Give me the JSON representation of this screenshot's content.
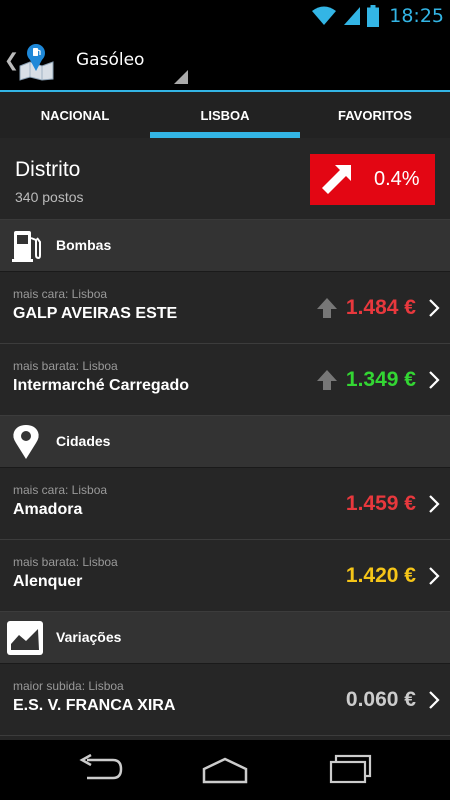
{
  "status_bar": {
    "time": "18:25",
    "icons": [
      "wifi-icon",
      "signal-icon",
      "battery-icon"
    ]
  },
  "action_bar": {
    "back_icon": "chevron-left-icon",
    "app_icon": "fuel-map-icon",
    "fuel_type": "Gasóleo"
  },
  "tabs": [
    {
      "label": "NACIONAL",
      "active": false
    },
    {
      "label": "LISBOA",
      "active": true
    },
    {
      "label": "FAVORITOS",
      "active": false
    }
  ],
  "district": {
    "title": "Distrito",
    "subtitle": "340 postos",
    "variation": "0.4%",
    "variation_icon": "arrow-up-right-icon",
    "variation_color": "#e30613"
  },
  "sections": {
    "bombas": {
      "label": "Bombas",
      "icon": "fuel-pump-icon",
      "rows": [
        {
          "caption": "mais cara: Lisboa",
          "name": "GALP AVEIRAS ESTE",
          "price": "1.484 €",
          "price_color": "#e8383d",
          "trend_icon": "arrow-up-icon"
        },
        {
          "caption": "mais barata: Lisboa",
          "name": "Intermarché Carregado",
          "price": "1.349 €",
          "price_color": "#33d633",
          "trend_icon": "arrow-up-icon"
        }
      ]
    },
    "cidades": {
      "label": "Cidades",
      "icon": "map-pin-icon",
      "rows": [
        {
          "caption": "mais cara: Lisboa",
          "name": "Amadora",
          "price": "1.459 €",
          "price_color": "#e8383d"
        },
        {
          "caption": "mais barata: Lisboa",
          "name": "Alenquer",
          "price": "1.420 €",
          "price_color": "#f5c518"
        }
      ]
    },
    "variacoes": {
      "label": "Variações",
      "icon": "area-chart-icon",
      "rows": [
        {
          "caption": "maior subida: Lisboa",
          "name": "E.S. V. FRANCA XIRA",
          "price": "0.060 €",
          "price_color": "#cccccc"
        }
      ]
    }
  },
  "navigation": {
    "icons": [
      "back-icon",
      "home-icon",
      "recent-apps-icon"
    ]
  }
}
